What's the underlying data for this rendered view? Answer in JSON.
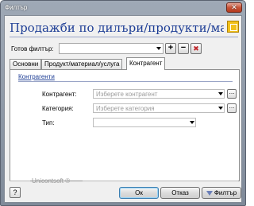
{
  "window": {
    "title": "Филтър",
    "close_label": "✕"
  },
  "header": {
    "title": "Продажби по дилъри/продукти/мат..."
  },
  "filter": {
    "label": "Готов филтър:",
    "value": "",
    "add_label": "+",
    "remove_label": "−",
    "clear_label": "✖"
  },
  "tabs": [
    {
      "label": "Основни"
    },
    {
      "label": "Продукт/материал/услуга"
    },
    {
      "label": "Контрагент",
      "active": true
    }
  ],
  "panel": {
    "group_title": "Контрагенти",
    "fields": {
      "contragent": {
        "label": "Контрагент:",
        "placeholder": "Изберете контрагент"
      },
      "category": {
        "label": "Категория:",
        "placeholder": "Изберете категория"
      },
      "type": {
        "label": "Тип:",
        "value": ""
      }
    },
    "ellipsis_label": "..."
  },
  "footer": {
    "brand": "Unicontsoft ®",
    "help_label": "?",
    "ok_label": "Ок",
    "cancel_label": "Отказ",
    "filter_label": "Филтър"
  },
  "colors": {
    "heading": "#1f3f96",
    "accent_icon": "#f2c11c",
    "close": "#c85337"
  }
}
